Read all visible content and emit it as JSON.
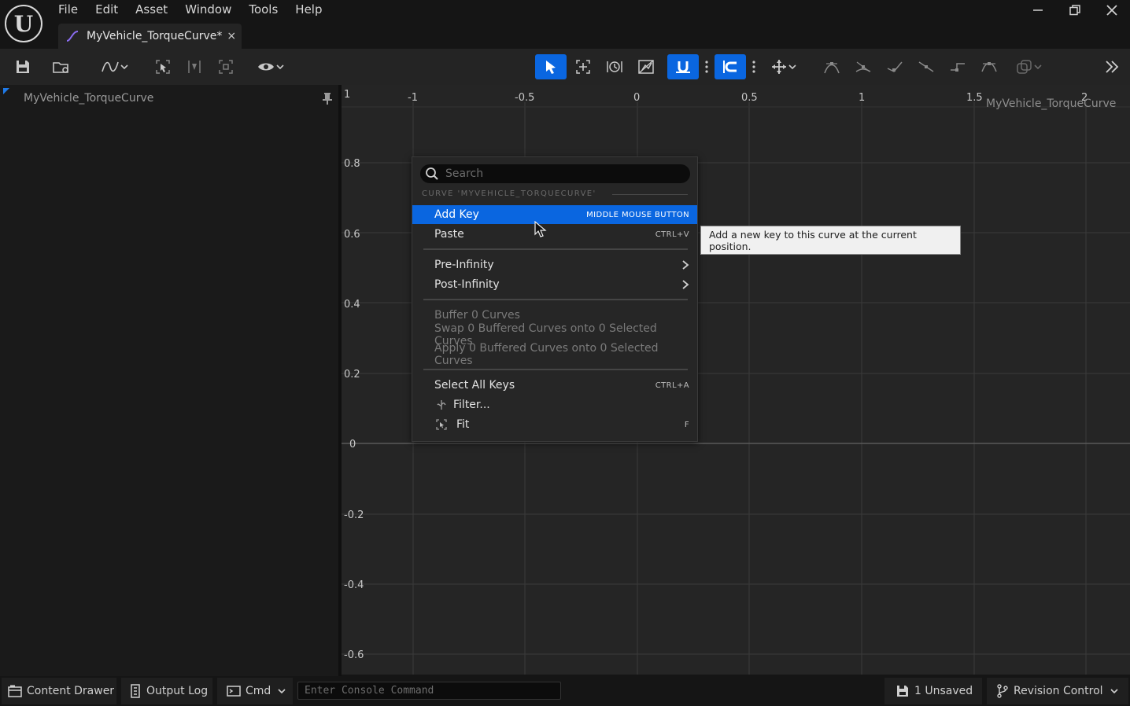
{
  "menubar": {
    "items": [
      "File",
      "Edit",
      "Asset",
      "Window",
      "Tools",
      "Help"
    ]
  },
  "asset_tab": {
    "label": "MyVehicle_TorqueCurve*",
    "close_glyph": "×"
  },
  "window_controls": {
    "minimize_glyph": "—",
    "restore_glyph": "❐",
    "close_glyph": "✕"
  },
  "left_panel": {
    "curve_name": "MyVehicle_TorqueCurve"
  },
  "graph": {
    "curve_label": "MyVehicle_TorqueCurve",
    "x_ticks": [
      "1",
      "-1",
      "-0.5",
      "0",
      "0.5",
      "1",
      "1.5",
      "2"
    ],
    "y_ticks": [
      "0.8",
      "0.6",
      "0.4",
      "0.2",
      "0",
      "-0.2",
      "-0.4",
      "-0.6"
    ]
  },
  "context_menu": {
    "search_placeholder": "Search",
    "section_header": "CURVE 'MYVEHICLE_TORQUECURVE'",
    "items": [
      {
        "label": "Add Key",
        "shortcut": "MIDDLE MOUSE BUTTON"
      },
      {
        "label": "Paste",
        "shortcut": "CTRL+V"
      },
      {
        "label": "Pre-Infinity"
      },
      {
        "label": "Post-Infinity"
      },
      {
        "label": "Buffer 0 Curves"
      },
      {
        "label": "Swap 0 Buffered Curves onto 0 Selected Curves"
      },
      {
        "label": "Apply 0 Buffered Curves onto 0 Selected Curves"
      },
      {
        "label": "Select All Keys",
        "shortcut": "CTRL+A"
      },
      {
        "label": "Filter..."
      },
      {
        "label": "Fit",
        "shortcut": "F"
      }
    ]
  },
  "tooltip": {
    "text": "Add a new key to this curve at the current position."
  },
  "statusbar": {
    "content_drawer": "Content Drawer",
    "output_log": "Output Log",
    "cmd": "Cmd",
    "console_placeholder": "Enter Console Command",
    "unsaved": "1 Unsaved",
    "revision_control": "Revision Control"
  },
  "colors": {
    "accent": "#0a66e0",
    "background": "#151515",
    "graph_background": "#252525"
  }
}
